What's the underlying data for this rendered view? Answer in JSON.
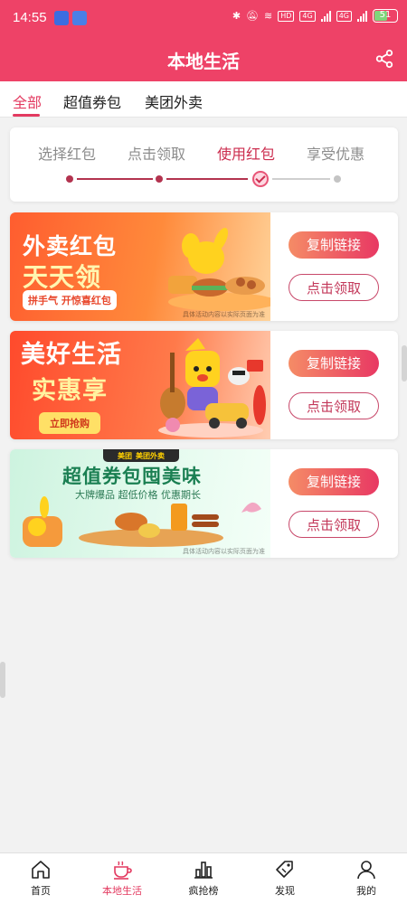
{
  "status_bar": {
    "time": "14:55",
    "network_badge_1": "4G",
    "network_badge_2": "4G",
    "hd_badge": "HD",
    "battery": "51"
  },
  "header": {
    "title": "本地生活"
  },
  "tabs": [
    {
      "label": "全部",
      "active": true
    },
    {
      "label": "超值券包",
      "active": false
    },
    {
      "label": "美团外卖",
      "active": false
    }
  ],
  "steps": [
    {
      "label": "选择红包",
      "active": false
    },
    {
      "label": "点击领取",
      "active": false
    },
    {
      "label": "使用红包",
      "active": true
    },
    {
      "label": "享受优惠",
      "active": false
    }
  ],
  "promos": [
    {
      "title_line1": "外卖红包",
      "title_line2": "天天领",
      "tag": "拼手气 开惊喜红包",
      "fine_print": "具体活动内容以实际页面为准",
      "copy_label": "复制链接",
      "claim_label": "点击领取"
    },
    {
      "title_line1": "美好生活",
      "title_line2": "实惠享",
      "tag": "立即抢购",
      "copy_label": "复制链接",
      "claim_label": "点击领取"
    },
    {
      "brand_1": "美团",
      "brand_2": "美团外卖",
      "title": "超值券包囤美味",
      "subtitle": "大牌爆品 超低价格 优惠期长",
      "fine_print": "具体活动内容以实际页面为准",
      "copy_label": "复制链接",
      "claim_label": "点击领取"
    }
  ],
  "bottom_nav": [
    {
      "label": "首页",
      "icon": "home-icon",
      "active": false
    },
    {
      "label": "本地生活",
      "icon": "coffee-cup-icon",
      "active": true
    },
    {
      "label": "疯抢榜",
      "icon": "bar-chart-icon",
      "active": false
    },
    {
      "label": "发现",
      "icon": "tag-icon",
      "active": false
    },
    {
      "label": "我的",
      "icon": "user-icon",
      "active": false
    }
  ],
  "colors": {
    "brand": "#ee4267",
    "accent_text": "#e33a60",
    "button_gradient_start": "#f58c66",
    "button_gradient_end": "#e83863"
  }
}
